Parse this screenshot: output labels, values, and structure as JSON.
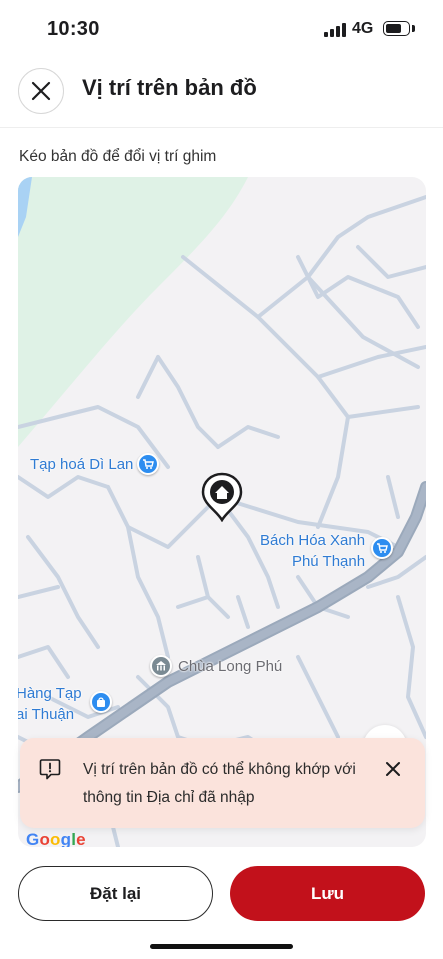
{
  "status_bar": {
    "time": "10:30",
    "network": "4G"
  },
  "header": {
    "title": "Vị trí trên bản đồ",
    "close_icon": "close-icon"
  },
  "instruction": "Kéo bản đồ để đổi vị trí ghim",
  "map": {
    "pois": [
      {
        "label": "Tạp hoá Dì Lan",
        "icon": "cart-icon"
      },
      {
        "label_line1": "Bách Hóa Xanh",
        "label_line2": "Phú Thạnh",
        "icon": "cart-icon"
      },
      {
        "label": "Chùa Long Phú",
        "icon": "temple-icon"
      },
      {
        "label_line1": "Hàng Tạp",
        "label_line2": "ai Thuận",
        "icon": "shopping-bag-icon"
      }
    ],
    "pin_icon": "home-pin-icon",
    "attribution": "Google",
    "colors": {
      "land": "#f3f2f4",
      "park": "#dff2e6",
      "water": "#a9d2f4",
      "road": "#c9d3e1",
      "highway": "#9ba9bb"
    }
  },
  "warning": {
    "icon": "warning-icon",
    "text": "Vị trí trên bản đồ có thể không khớp với thông tin Địa chỉ đã nhập",
    "close_icon": "close-icon"
  },
  "actions": {
    "reset_label": "Đặt lại",
    "save_label": "Lưu"
  },
  "colors": {
    "primary": "#c2111b",
    "toast_bg": "#fbe3dc",
    "poi_blue": "#2d8df0"
  }
}
